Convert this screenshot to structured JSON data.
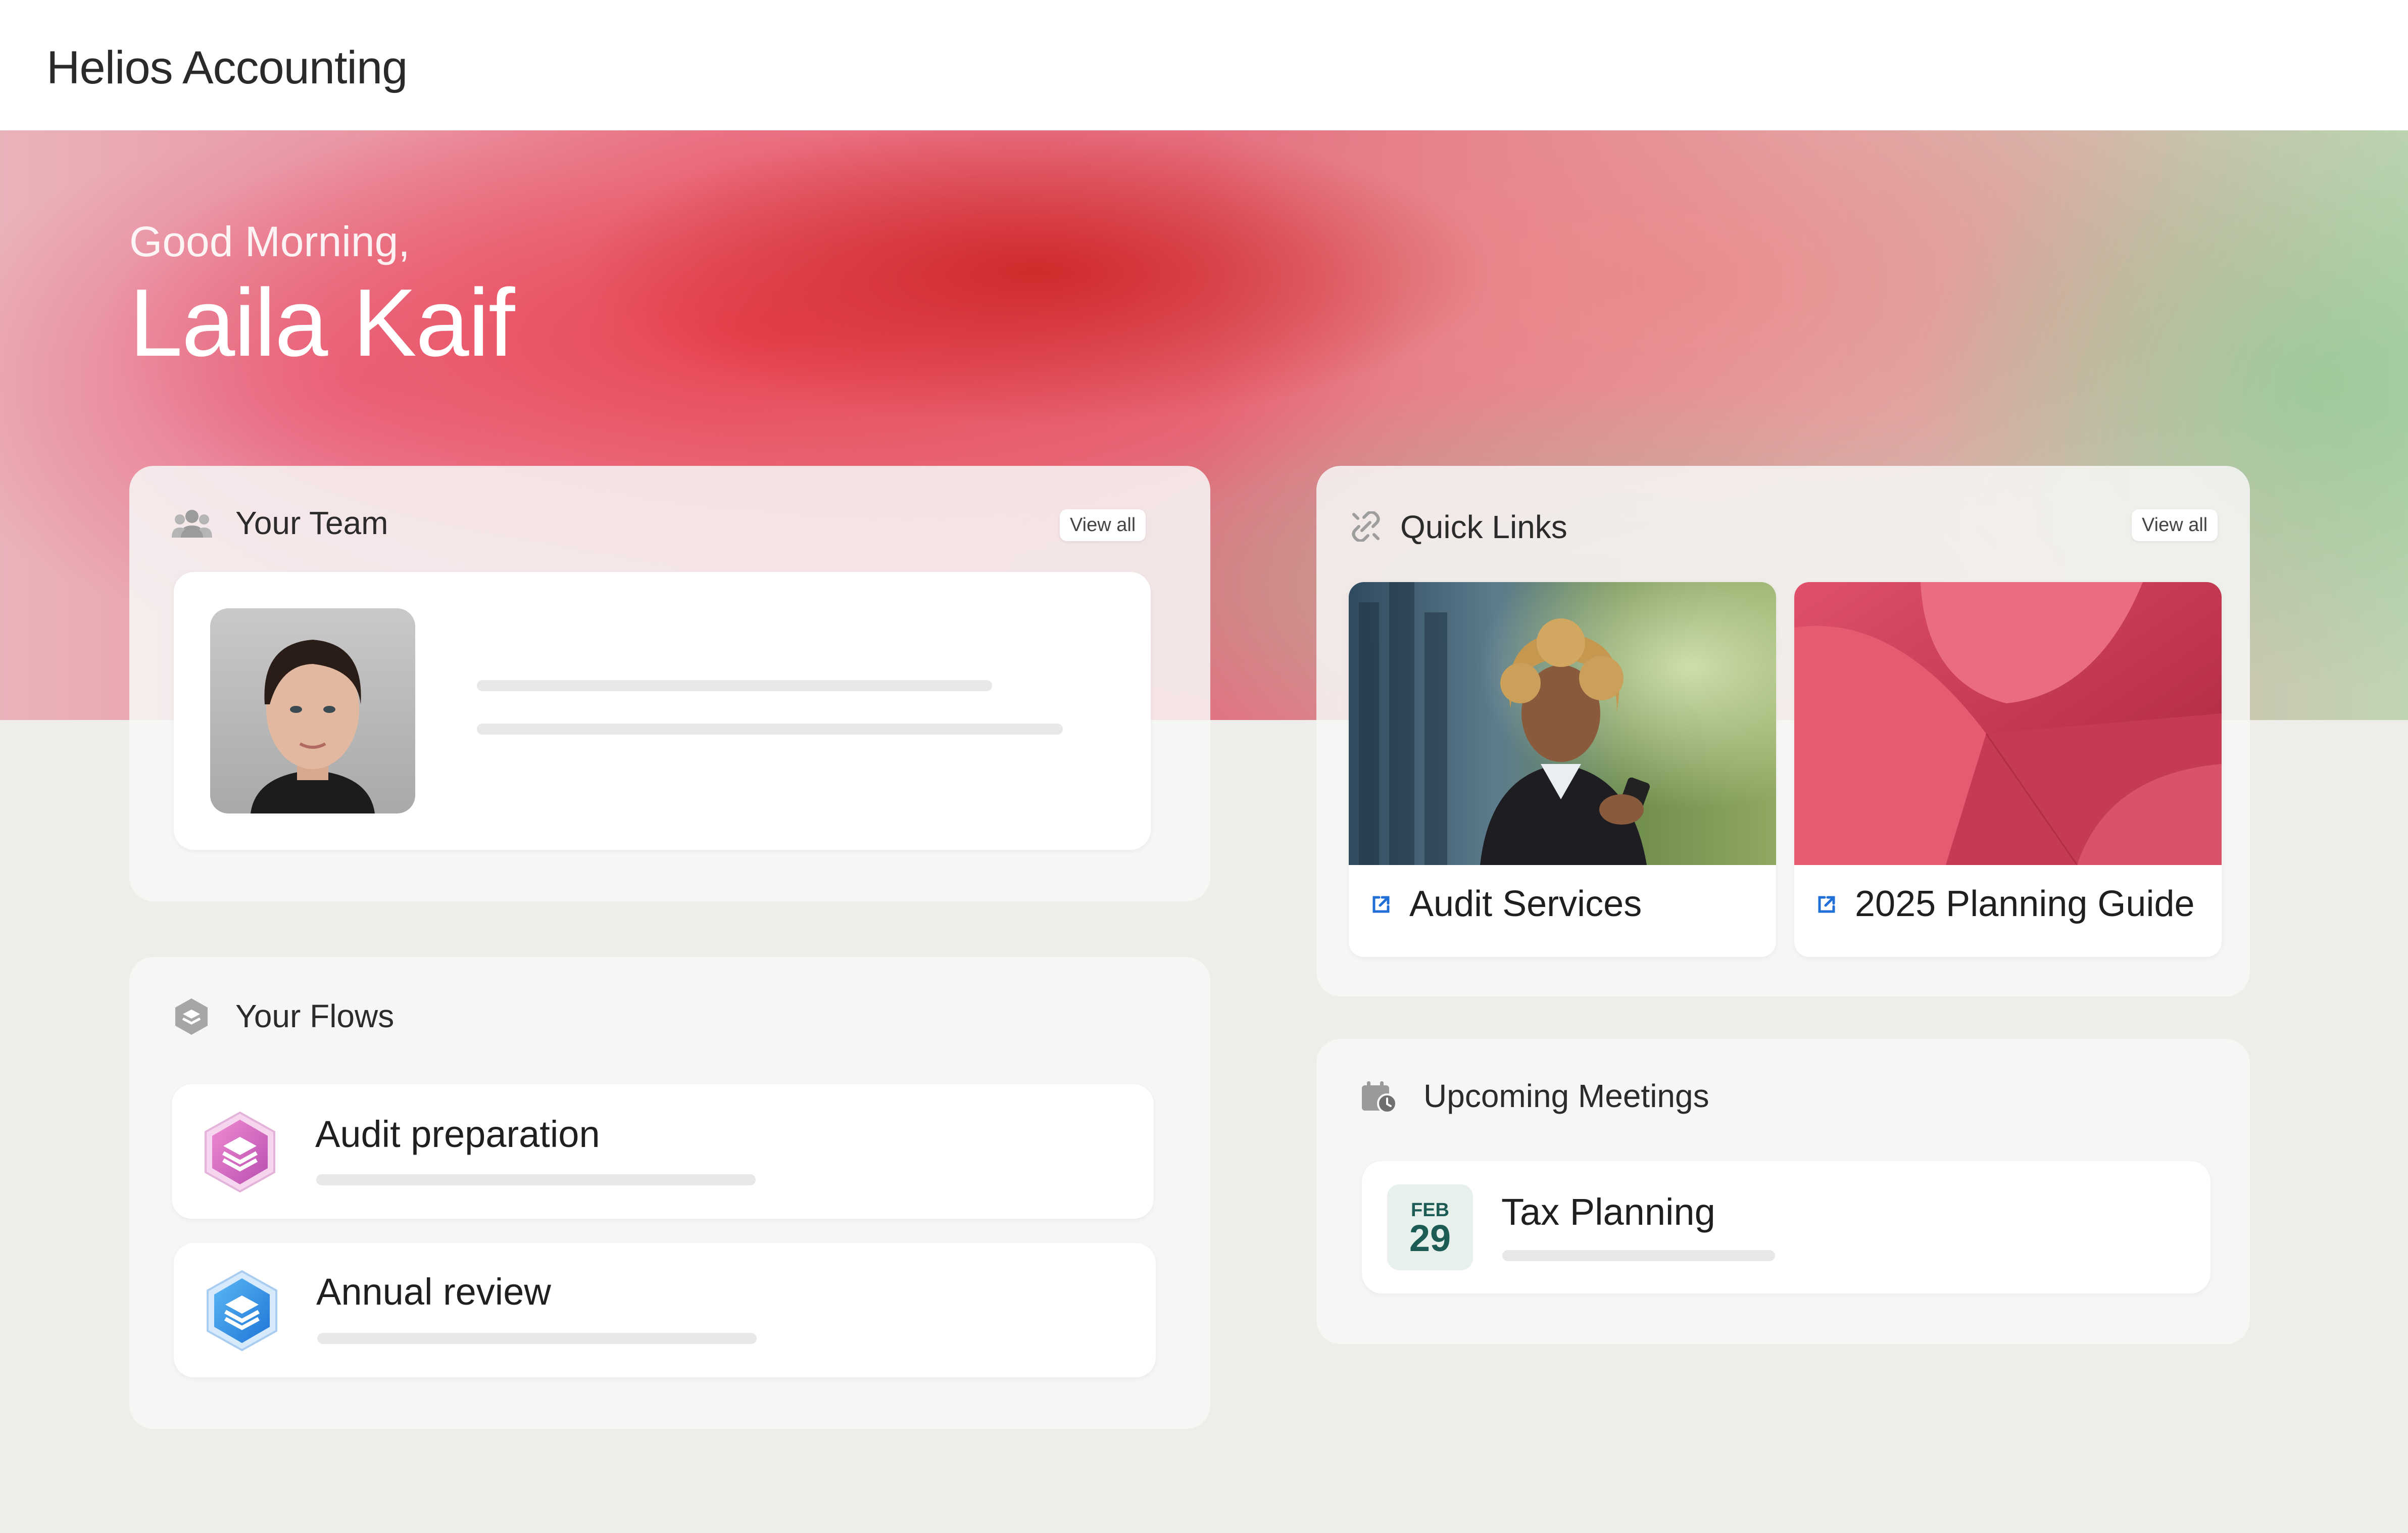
{
  "app": {
    "title": "Helios Accounting"
  },
  "hero": {
    "greeting": "Good Morning,",
    "name": "Laila Kaif"
  },
  "team": {
    "title": "Your Team",
    "view_all": "View all",
    "icon": "team-icon"
  },
  "quick_links": {
    "title": "Quick Links",
    "view_all": "View all",
    "icon": "link-icon",
    "items": [
      {
        "label": "Audit Services",
        "icon": "external-link-icon"
      },
      {
        "label": "2025 Planning Guide",
        "icon": "external-link-icon"
      }
    ]
  },
  "flows": {
    "title": "Your Flows",
    "icon": "flows-icon",
    "items": [
      {
        "label": "Audit preparation",
        "color": "#d86ac0"
      },
      {
        "label": "Annual review",
        "color": "#3a8fe0"
      }
    ]
  },
  "meetings": {
    "title": "Upcoming Meetings",
    "icon": "calendar-clock-icon",
    "items": [
      {
        "month": "FEB",
        "day": "29",
        "title": "Tax Planning"
      }
    ]
  },
  "colors": {
    "accent_blue": "#1f6fd6",
    "date_green": "#1c5c54",
    "date_bg": "#e8f0ec"
  }
}
